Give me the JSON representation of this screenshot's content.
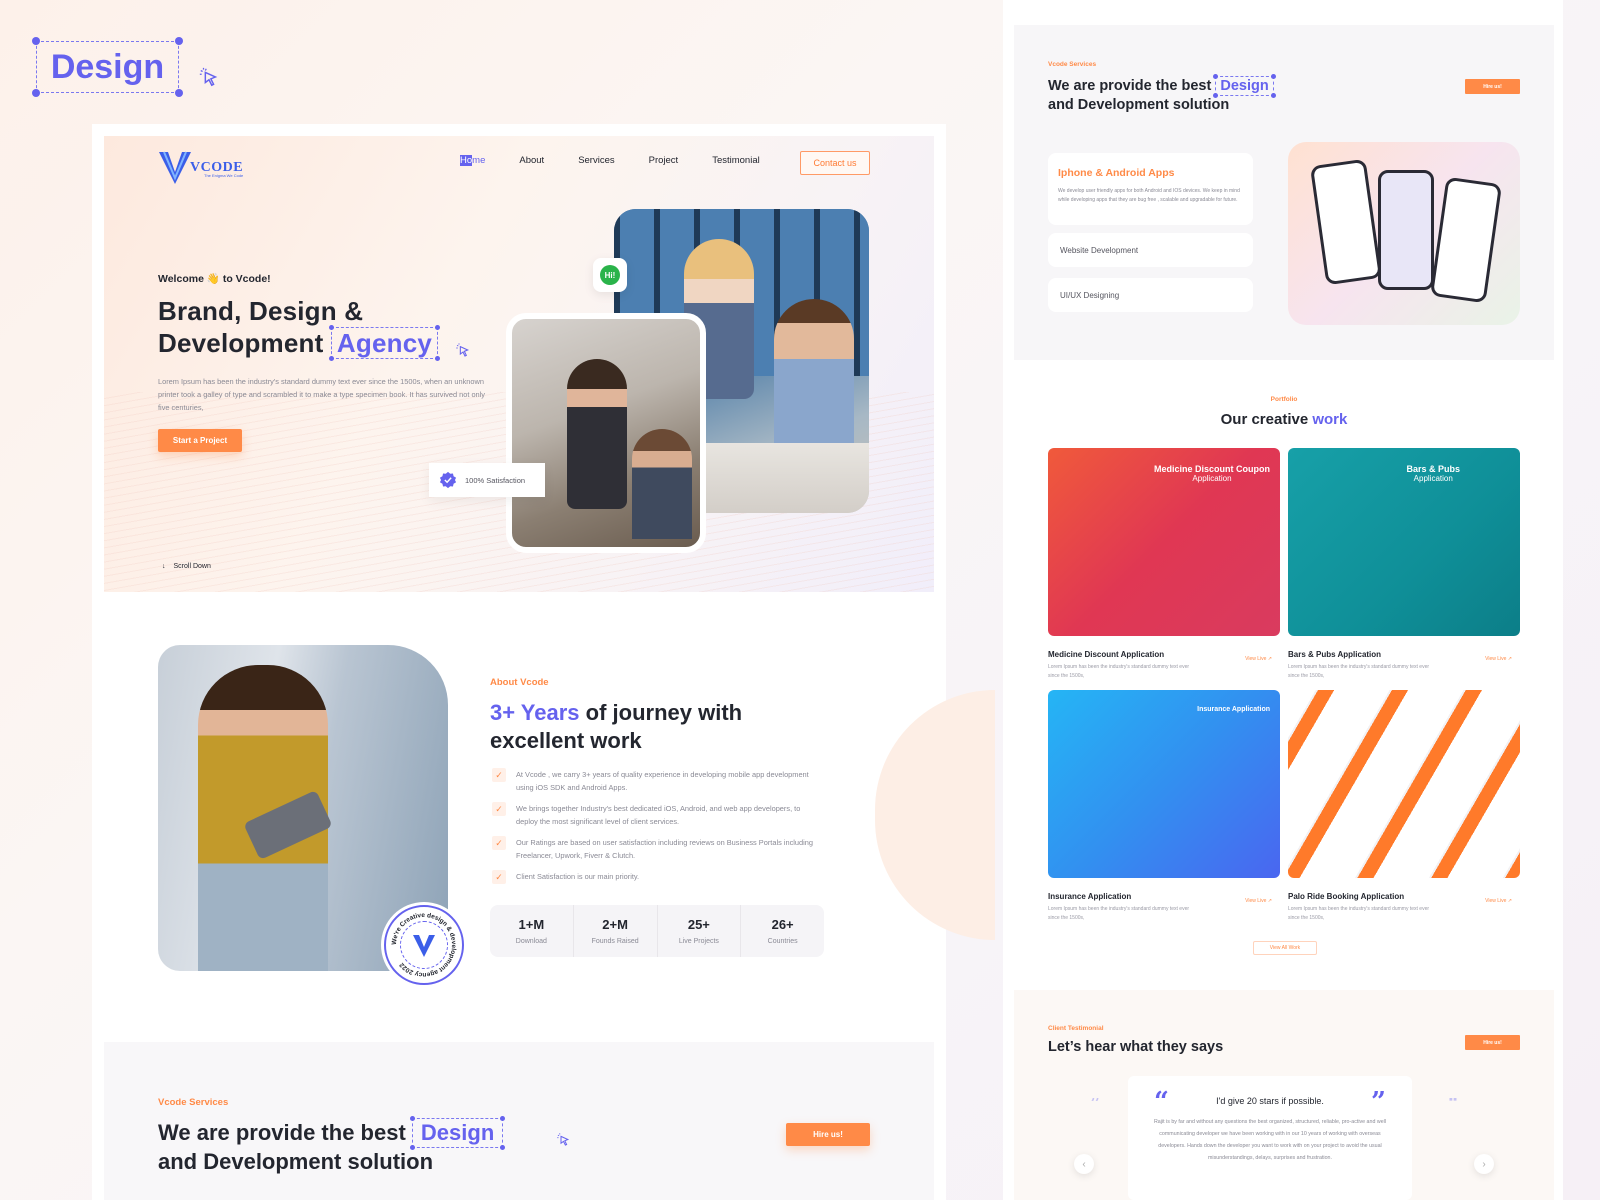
{
  "badge": {
    "label": "Design"
  },
  "nav": {
    "brand": "VCODE",
    "tagline": "The Enigma We Code",
    "items": [
      {
        "label_hl": "Ho",
        "label_rest": "me",
        "active": true
      },
      {
        "label": "About"
      },
      {
        "label": "Services"
      },
      {
        "label": "Project"
      },
      {
        "label": "Testimonial"
      }
    ],
    "contact": "Contact us"
  },
  "hero": {
    "welcome_pre": "Welcome",
    "welcome_emoji": "👋",
    "welcome_post": "to Vcode!",
    "title_line1": "Brand, Design &",
    "title_line2": "Development",
    "title_highlight": "Agency",
    "description": "Lorem Ipsum has been the industry's standard dummy text ever since the 1500s, when an unknown printer took a galley of type and scrambled it to make a type specimen book. It has survived not only five centuries,",
    "cta": "Start a Project",
    "hi_bubble": "Hi!",
    "satisfaction": "100% Satisfaction",
    "scroll": "Scroll Down"
  },
  "about": {
    "label": "About Vcode",
    "title_highlight": "3+ Years",
    "title_rest": "of journey with excellent work",
    "seal_text": "We're Creative design & development agency 2022",
    "points": [
      "At Vcode , we carry 3+ years of quality experience in developing mobile app development using iOS SDK and Android Apps.",
      "We brings together Industry's best dedicated iOS, Android, and web app developers, to deploy the most significant level of client services.",
      "Our Ratings are based on user satisfaction including reviews on Business Portals including Freelancer, Upwork, Fiverr & Clutch.",
      "Client Satisfaction is our main priority."
    ],
    "stats": [
      {
        "value": "1+M",
        "label": "Download"
      },
      {
        "value": "2+M",
        "label": "Founds Raised"
      },
      {
        "value": "25+",
        "label": "Live Projects"
      },
      {
        "value": "26+",
        "label": "Countries"
      }
    ]
  },
  "services": {
    "label": "Vcode Services",
    "title_pre": "We are provide the best",
    "title_highlight": "Design",
    "title_post": "and Development solution",
    "hire": "Hire us!",
    "cards": [
      {
        "title": "Iphone & Android Apps",
        "desc": "We develop user friendly apps for both Android and IOS devices. We keep in mind while developing apps that they are bug free , scalable and upgradable for future."
      },
      {
        "title": "Website Development"
      },
      {
        "title": "UI/UX Designing"
      }
    ]
  },
  "portfolio": {
    "label": "Portfolio",
    "title_pre": "Our creative",
    "title_highlight": "work",
    "view_all": "View All Work",
    "projects": [
      {
        "name": "Medicine Discount Application",
        "desc": "Lorem Ipsum has been the industry's standard dummy text ever since the 1500s,",
        "link": "View Live ↗",
        "caption": "Medicine Discount Coupon",
        "caption_sub": "Application"
      },
      {
        "name": "Bars & Pubs Application",
        "desc": "Lorem Ipsum has been the industry's standard dummy text ever since the 1500s,",
        "link": "View Live ↗",
        "caption": "Bars & Pubs",
        "caption_sub": "Application"
      },
      {
        "name": "Insurance Application",
        "desc": "Lorem Ipsum has been the industry's standard dummy text ever since the 1500s,",
        "link": "View Live ↗",
        "caption": "Insurance Application",
        "caption_sub": ""
      },
      {
        "name": "Palo Ride Booking Application",
        "desc": "Lorem Ipsum has been the industry's standard dummy text ever since the 1500s,",
        "link": "View Live ↗",
        "caption": "",
        "caption_sub": ""
      }
    ]
  },
  "testimonial": {
    "label": "Client Testimonial",
    "title": "Let’s hear what they says",
    "hire": "Hire us!",
    "headline": "I'd give 20 stars if possible.",
    "body": "Rajit is by far and without any questions the best organized, structured, reliable, pro-active and well communicating developer we have been working with in our 10 years of working with overseas developers. Hands down the developer you want to work with on your project to avoid the usual misunderstandings, delays, surprises and frustration.",
    "prev": "‹",
    "next": "›"
  },
  "colors": {
    "accent": "#6562ee",
    "brand_orange": "#ff8a47"
  }
}
